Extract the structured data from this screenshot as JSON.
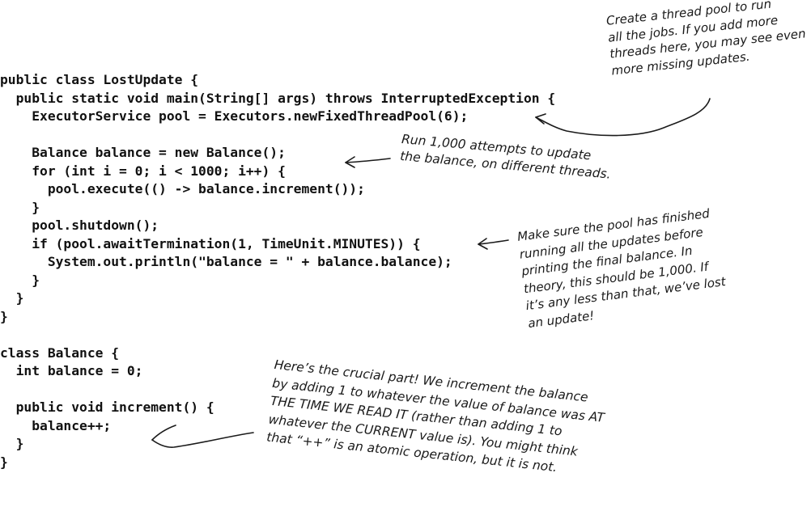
{
  "code": {
    "lines": [
      "public class LostUpdate {",
      "  public static void main(String[] args) throws InterruptedException {",
      "    ExecutorService pool = Executors.newFixedThreadPool(6);",
      "",
      "    Balance balance = new Balance();",
      "    for (int i = 0; i < 1000; i++) {",
      "      pool.execute(() -> balance.increment());",
      "    }",
      "    pool.shutdown();",
      "    if (pool.awaitTermination(1, TimeUnit.MINUTES)) {",
      "      System.out.println(\"balance = \" + balance.balance);",
      "    }",
      "  }",
      "}",
      "",
      "class Balance {",
      "  int balance = 0;",
      "",
      "  public void increment() {",
      "    balance++;",
      "  }",
      "}"
    ]
  },
  "annotations": {
    "thread_pool": [
      "Create a thread pool to run",
      "all the jobs. If you add more",
      "threads here, you may see even",
      "more missing updates."
    ],
    "attempts": [
      "Run 1,000 attempts to update",
      "the balance, on different threads."
    ],
    "pool_finished": [
      "Make sure the pool has finished",
      "running all the updates before",
      "printing the final balance. In",
      "theory, this should be 1,000. If",
      "it’s any less than that, we’ve lost",
      "an update!"
    ],
    "crucial_part": [
      "Here’s the crucial part! We increment the balance",
      "by adding 1 to whatever the value of balance was AT",
      "THE TIME WE READ IT (rather than adding 1 to",
      "whatever the CURRENT value is). You might think",
      "that “++” is an atomic operation, but it is not."
    ]
  }
}
